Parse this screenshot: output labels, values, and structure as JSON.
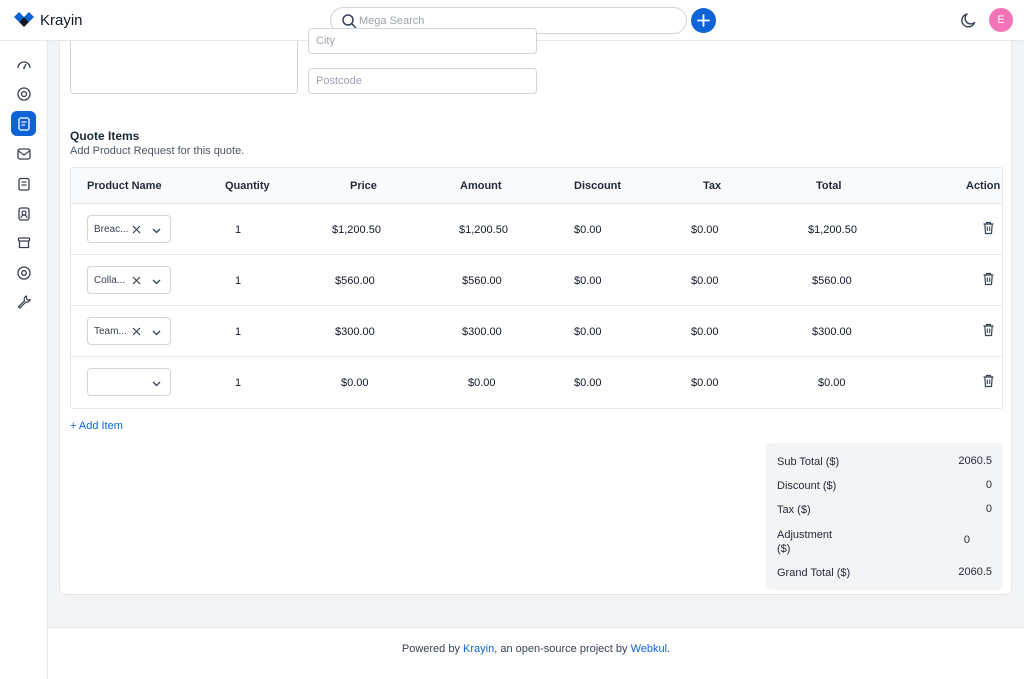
{
  "app": {
    "name": "Krayin"
  },
  "search": {
    "placeholder": "Mega Search"
  },
  "user": {
    "avatar_letter": "E",
    "avatar_color": "#f472b6"
  },
  "colors": {
    "accent": "#0e64d6"
  },
  "sidebar": {
    "items": [
      {
        "icon": "dashboard-icon"
      },
      {
        "icon": "leads-icon"
      },
      {
        "icon": "quotes-icon",
        "active": true
      },
      {
        "icon": "mail-icon"
      },
      {
        "icon": "activities-icon"
      },
      {
        "icon": "contacts-icon"
      },
      {
        "icon": "products-icon"
      },
      {
        "icon": "settings-icon"
      },
      {
        "icon": "configuration-icon"
      }
    ]
  },
  "address": {
    "city_placeholder": "City",
    "postcode_placeholder": "Postcode"
  },
  "quote_items": {
    "title": "Quote Items",
    "subtitle": "Add Product Request for this quote.",
    "columns": [
      "Product Name",
      "Quantity",
      "Price",
      "Amount",
      "Discount",
      "Tax",
      "Total",
      "Action"
    ],
    "rows": [
      {
        "product": "Breac...",
        "quantity": "1",
        "price": "$1,200.50",
        "amount": "$1,200.50",
        "discount": "$0.00",
        "tax": "$0.00",
        "total": "$1,200.50"
      },
      {
        "product": "Colla...",
        "quantity": "1",
        "price": "$560.00",
        "amount": "$560.00",
        "discount": "$0.00",
        "tax": "$0.00",
        "total": "$560.00"
      },
      {
        "product": "Team...",
        "quantity": "1",
        "price": "$300.00",
        "amount": "$300.00",
        "discount": "$0.00",
        "tax": "$0.00",
        "total": "$300.00"
      },
      {
        "product": "",
        "quantity": "1",
        "price": "$0.00",
        "amount": "$0.00",
        "discount": "$0.00",
        "tax": "$0.00",
        "total": "$0.00"
      }
    ],
    "add_item_label": "+ Add Item"
  },
  "summary": {
    "sub_total_label": "Sub Total ($)",
    "sub_total": "2060.5",
    "discount_label": "Discount ($)",
    "discount": "0",
    "tax_label": "Tax ($)",
    "tax": "0",
    "adjustment_label_1": "Adjustment",
    "adjustment_label_2": "($)",
    "adjustment": "0",
    "grand_total_label": "Grand Total ($)",
    "grand_total": "2060.5"
  },
  "footer": {
    "prefix": "Powered by ",
    "link1": "Krayin",
    "middle": ", an open-source project by ",
    "link2": "Webkul",
    "suffix": "."
  }
}
